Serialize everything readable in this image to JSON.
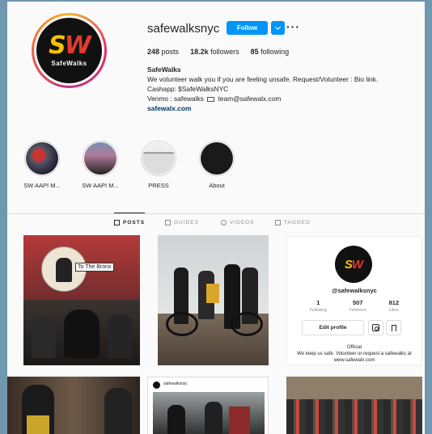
{
  "profile": {
    "username": "safewalksnyc",
    "follow_label": "Follow",
    "more_label": "···",
    "avatar_text": "SafeWalks",
    "logo_letters": "SW",
    "stats": [
      {
        "value": "248",
        "label": "posts"
      },
      {
        "value": "18.2k",
        "label": "followers"
      },
      {
        "value": "85",
        "label": "following"
      }
    ],
    "bio": {
      "name": "SafeWalks",
      "line1": "We volunteer walk you if you are feeling unsafe. Request/Volunteer : Bio link.",
      "line2": "Cashapp: $SafeWalksNYC",
      "line3_a": "Venmo : safewalks",
      "line3_b": "team@safewalx.com",
      "link": "safewalx.com"
    }
  },
  "highlights": [
    {
      "label": "SW AAPI M..."
    },
    {
      "label": "SW AAPI M..."
    },
    {
      "label": "PRESS"
    },
    {
      "label": "About"
    }
  ],
  "tabs": [
    {
      "label": "POSTS",
      "active": true
    },
    {
      "label": "GUIDES",
      "active": false
    },
    {
      "label": "VIDEOS",
      "active": false
    },
    {
      "label": "TAGGED",
      "active": false
    }
  ],
  "posts": {
    "p1_caption": "To The Bronx",
    "p5_header": "safewalksnyc",
    "card": {
      "username": "@safewalksnyc",
      "stats": [
        {
          "value": "1",
          "label": "Following"
        },
        {
          "value": "507",
          "label": "Followers"
        },
        {
          "value": "812",
          "label": "Likes"
        }
      ],
      "edit_label": "Edit profile",
      "bio_line1": "Official",
      "bio_line2": "We keep us safe. Volunteer or request a safewalks at",
      "bio_line3": "www.safewalx.com"
    }
  },
  "colors": {
    "follow_blue": "#0095f6",
    "frame": "#6f97ad",
    "logo_yellow": "#f6c200",
    "logo_red": "#e23a2e"
  }
}
